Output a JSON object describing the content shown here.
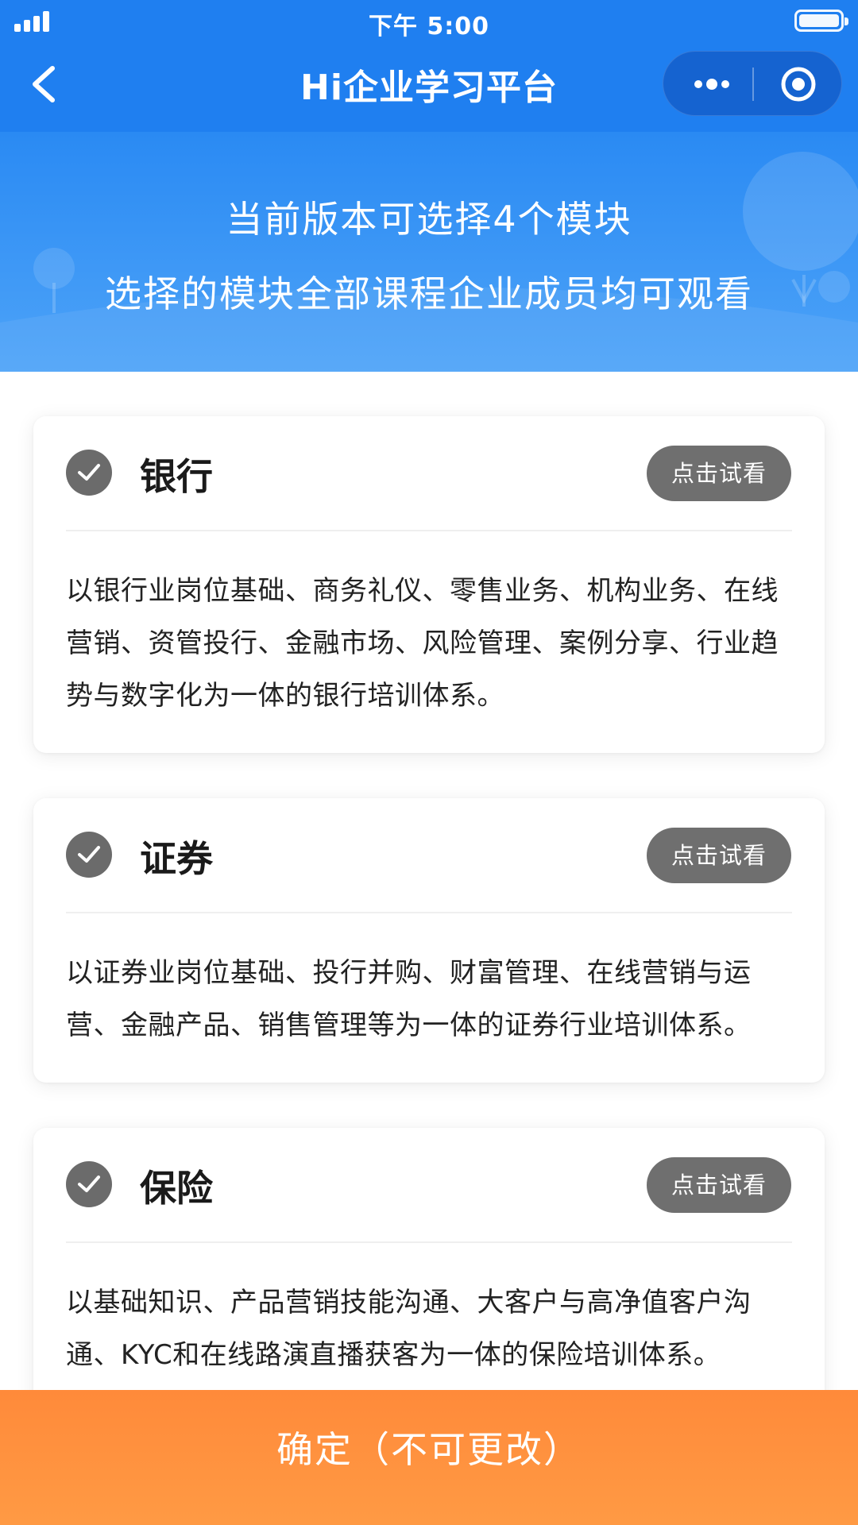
{
  "status_bar": {
    "time": "下午 5:00"
  },
  "nav": {
    "title": "Hi企业学习平台"
  },
  "banner": {
    "line1": "当前版本可选择4个模块",
    "line2": "选择的模块全部课程企业成员均可观看"
  },
  "modules": [
    {
      "title": "银行",
      "try_label": "点击试看",
      "description": "以银行业岗位基础、商务礼仪、零售业务、机构业务、在线营销、资管投行、金融市场、风险管理、案例分享、行业趋势与数字化为一体的银行培训体系。",
      "checked": true
    },
    {
      "title": "证券",
      "try_label": "点击试看",
      "description": "以证券业岗位基础、投行并购、财富管理、在线营销与运营、金融产品、销售管理等为一体的证券行业培训体系。",
      "checked": true
    },
    {
      "title": "保险",
      "try_label": "点击试看",
      "description": "以基础知识、产品营销技能沟通、大客户与高净值客户沟通、KYC和在线路演直播获客为一体的保险培训体系。",
      "checked": true
    }
  ],
  "confirm": {
    "label": "确定（不可更改）"
  },
  "colors": {
    "primary_blue": "#1f7ff0",
    "banner_blue": "#4da3f8",
    "check_gray": "#6b6b6b",
    "try_button_gray": "#6f6f6f",
    "confirm_orange": "#ff9040"
  },
  "icons": {
    "back": "chevron-left-icon",
    "more": "more-dots-icon",
    "close": "target-circle-icon",
    "check": "check-icon",
    "signal": "signal-bars-icon",
    "battery": "battery-icon"
  }
}
